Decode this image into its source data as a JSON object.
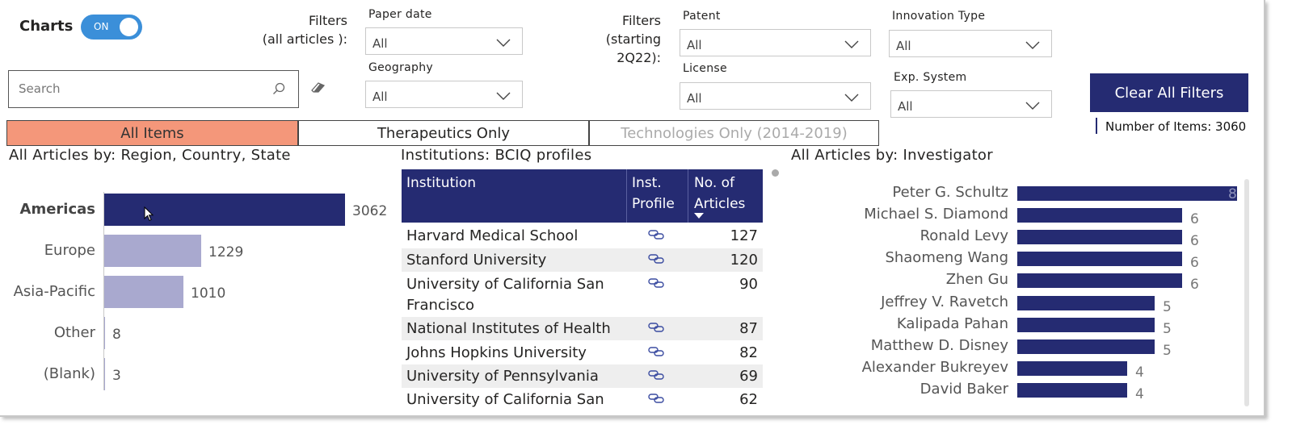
{
  "charts_toggle": {
    "label": "Charts",
    "state": "ON"
  },
  "search": {
    "placeholder": "Search"
  },
  "filters_all": {
    "label_line1": "Filters",
    "label_line2": "(all articles ):"
  },
  "filters_2q22": {
    "label_line1": "Filters",
    "label_line2": "(starting 2Q22):"
  },
  "slicers": {
    "paper_date": {
      "label": "Paper date",
      "value": "All"
    },
    "geography": {
      "label": "Geography",
      "value": "All"
    },
    "patent": {
      "label": "Patent",
      "value": "All"
    },
    "license": {
      "label": "License",
      "value": "All"
    },
    "innovation_type": {
      "label": "Innovation Type",
      "value": "All"
    },
    "exp_system": {
      "label": "Exp. System",
      "value": "All"
    }
  },
  "clear_button": "Clear All Filters",
  "item_count": "Number of Items: 3060",
  "tabs": [
    {
      "label": "All Items",
      "active": true
    },
    {
      "label": "Therapeutics Only",
      "active": false
    },
    {
      "label": "Technologies Only (2014-2019)",
      "active": false,
      "disabled": true
    }
  ],
  "region_section": {
    "title": "All Articles by: Region, Country, State"
  },
  "institutions_section": {
    "title": "Institutions: BCIQ profiles"
  },
  "investigator_section": {
    "title": "All Articles by: Investigator"
  },
  "table": {
    "headers": {
      "institution": "Institution",
      "profile_1": "Inst.",
      "profile_2": "Profile",
      "articles_1": "No. of",
      "articles_2": "Articles"
    },
    "rows": [
      {
        "name": "Harvard Medical School",
        "name2": "",
        "articles": "127"
      },
      {
        "name": "Stanford University",
        "name2": "",
        "articles": "120"
      },
      {
        "name": "University of California San",
        "name2": "Francisco",
        "articles": "90"
      },
      {
        "name": "National Institutes of Health",
        "name2": "",
        "articles": "87"
      },
      {
        "name": "Johns Hopkins University",
        "name2": "",
        "articles": "82"
      },
      {
        "name": "University of Pennsylvania",
        "name2": "",
        "articles": "69"
      },
      {
        "name": "University of California San",
        "name2": "",
        "articles": "62"
      }
    ]
  },
  "colors": {
    "primary": "#252b72",
    "accent": "#f4977a",
    "muted_bar": "#a9a9cf",
    "toggle": "#3b8fd9"
  },
  "chart_data": [
    {
      "type": "bar",
      "orientation": "horizontal",
      "title": "All Articles by: Region, Country, State",
      "categories": [
        "Americas",
        "Europe",
        "Asia-Pacific",
        "Other",
        "(Blank)"
      ],
      "values": [
        3062,
        1229,
        1010,
        8,
        3
      ],
      "highlighted": "Americas",
      "xlim": [
        0,
        3062
      ]
    },
    {
      "type": "bar",
      "orientation": "horizontal",
      "title": "All Articles by: Investigator",
      "categories": [
        "Peter G. Schultz",
        "Michael S. Diamond",
        "Ronald Levy",
        "Shaomeng Wang",
        "Zhen Gu",
        "Jeffrey V. Ravetch",
        "Kalipada Pahan",
        "Matthew D. Disney",
        "Alexander Bukreyev",
        "David Baker"
      ],
      "values": [
        8,
        6,
        6,
        6,
        6,
        5,
        5,
        5,
        4,
        4
      ],
      "xlim": [
        0,
        8
      ]
    }
  ]
}
